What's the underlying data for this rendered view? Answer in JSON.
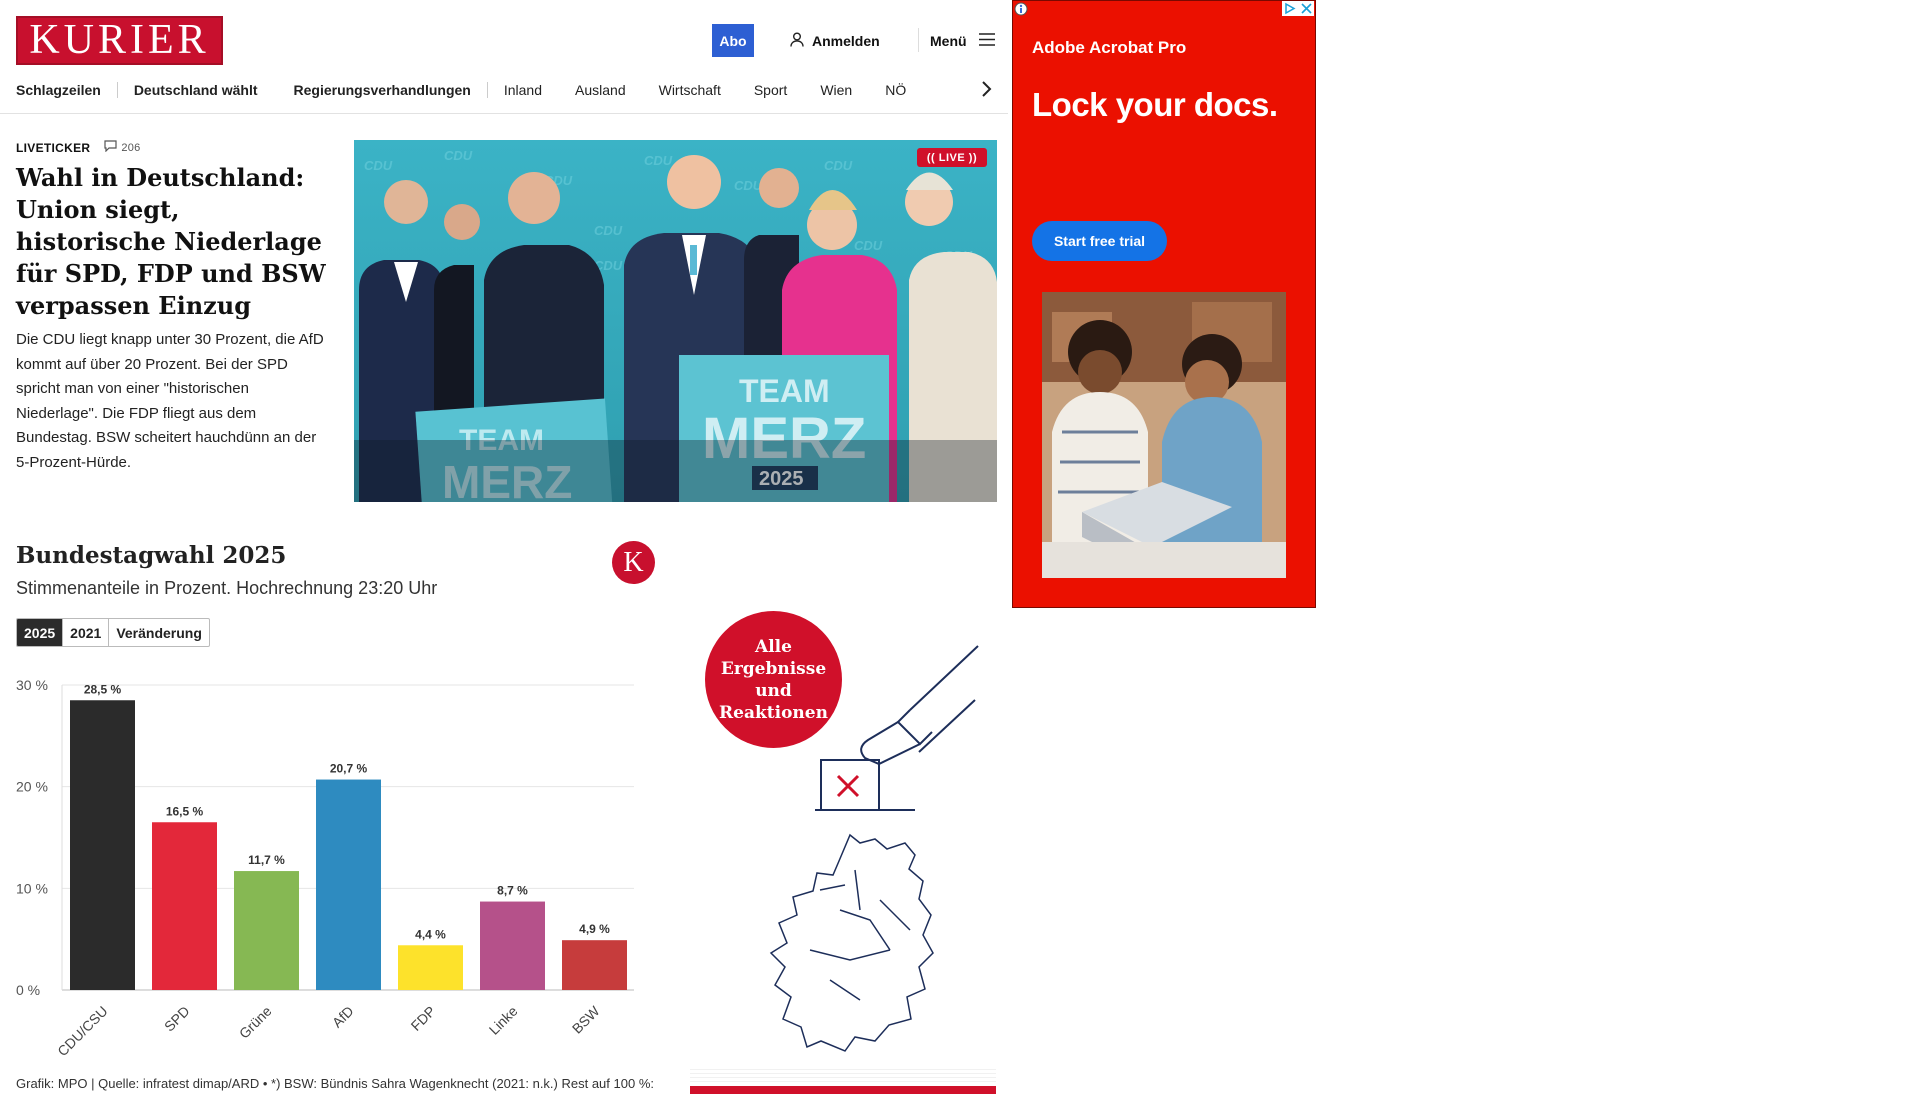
{
  "header": {
    "logo_text": "KURIER",
    "abo_label": "Abo",
    "login_label": "Anmelden",
    "menu_label": "Menü"
  },
  "nav": {
    "items": [
      "Schlagzeilen",
      "Deutschland wählt",
      "Regierungsverhandlungen",
      "Inland",
      "Ausland",
      "Wirtschaft",
      "Sport",
      "Wien",
      "NÖ"
    ]
  },
  "article": {
    "kicker": "LIVETICKER",
    "comment_count": "206",
    "headline": "Wahl in Deutschland: Union siegt, historische Niederlage für SPD, FDP und BSW verpassen Einzug",
    "teaser": "Die CDU liegt knapp unter 30 Prozent, die AfD kommt auf über 20 Prozent. Bei der SPD spricht man von einer \"historischen Niederlage\". Die FDP fliegt aus dem Bundestag. BSW scheitert hauchdünn an der 5-Prozent-Hürde.",
    "live_badge": "LIVE",
    "photo_signs": [
      "TEAM",
      "MERZ",
      "2025",
      "CDU"
    ]
  },
  "chart_widget": {
    "title": "Bundestagwahl 2025",
    "subtitle": "Stimmenanteile in Prozent. Hochrechnung 23:20 Uhr",
    "badge": "K",
    "toggle": [
      "2025",
      "2021",
      "Veränderung"
    ],
    "active_toggle": "2025",
    "footnote": "Grafik: MPO | Quelle: infratest dimap/ARD • *) BSW: Bündnis Sahra Wagenknecht (2021: n.k.) Rest auf 100 %:"
  },
  "chart_data": {
    "type": "bar",
    "categories": [
      "CDU/CSU",
      "SPD",
      "Grüne",
      "AfD",
      "FDP",
      "Linke",
      "BSW"
    ],
    "values": [
      28.5,
      16.5,
      11.7,
      20.7,
      4.4,
      8.7,
      4.9
    ],
    "value_labels": [
      "28,5 %",
      "16,5 %",
      "11,7 %",
      "20,7 %",
      "4,4 %",
      "8,7 %",
      "4,9 %"
    ],
    "colors": [
      "#2b2b2b",
      "#e3283a",
      "#86b853",
      "#2e8bc0",
      "#fde22b",
      "#b5518a",
      "#c63c3c"
    ],
    "yticks": [
      "0 %",
      "10 %",
      "20 %",
      "30 %"
    ],
    "ylim": [
      0,
      30
    ],
    "grid": true
  },
  "results_promo": {
    "lines": [
      "Alle",
      "Ergebnisse",
      "und",
      "Reaktionen"
    ]
  },
  "ad": {
    "brand": "Adobe Acrobat Pro",
    "headline": "Lock your docs.",
    "cta": "Start free trial"
  }
}
